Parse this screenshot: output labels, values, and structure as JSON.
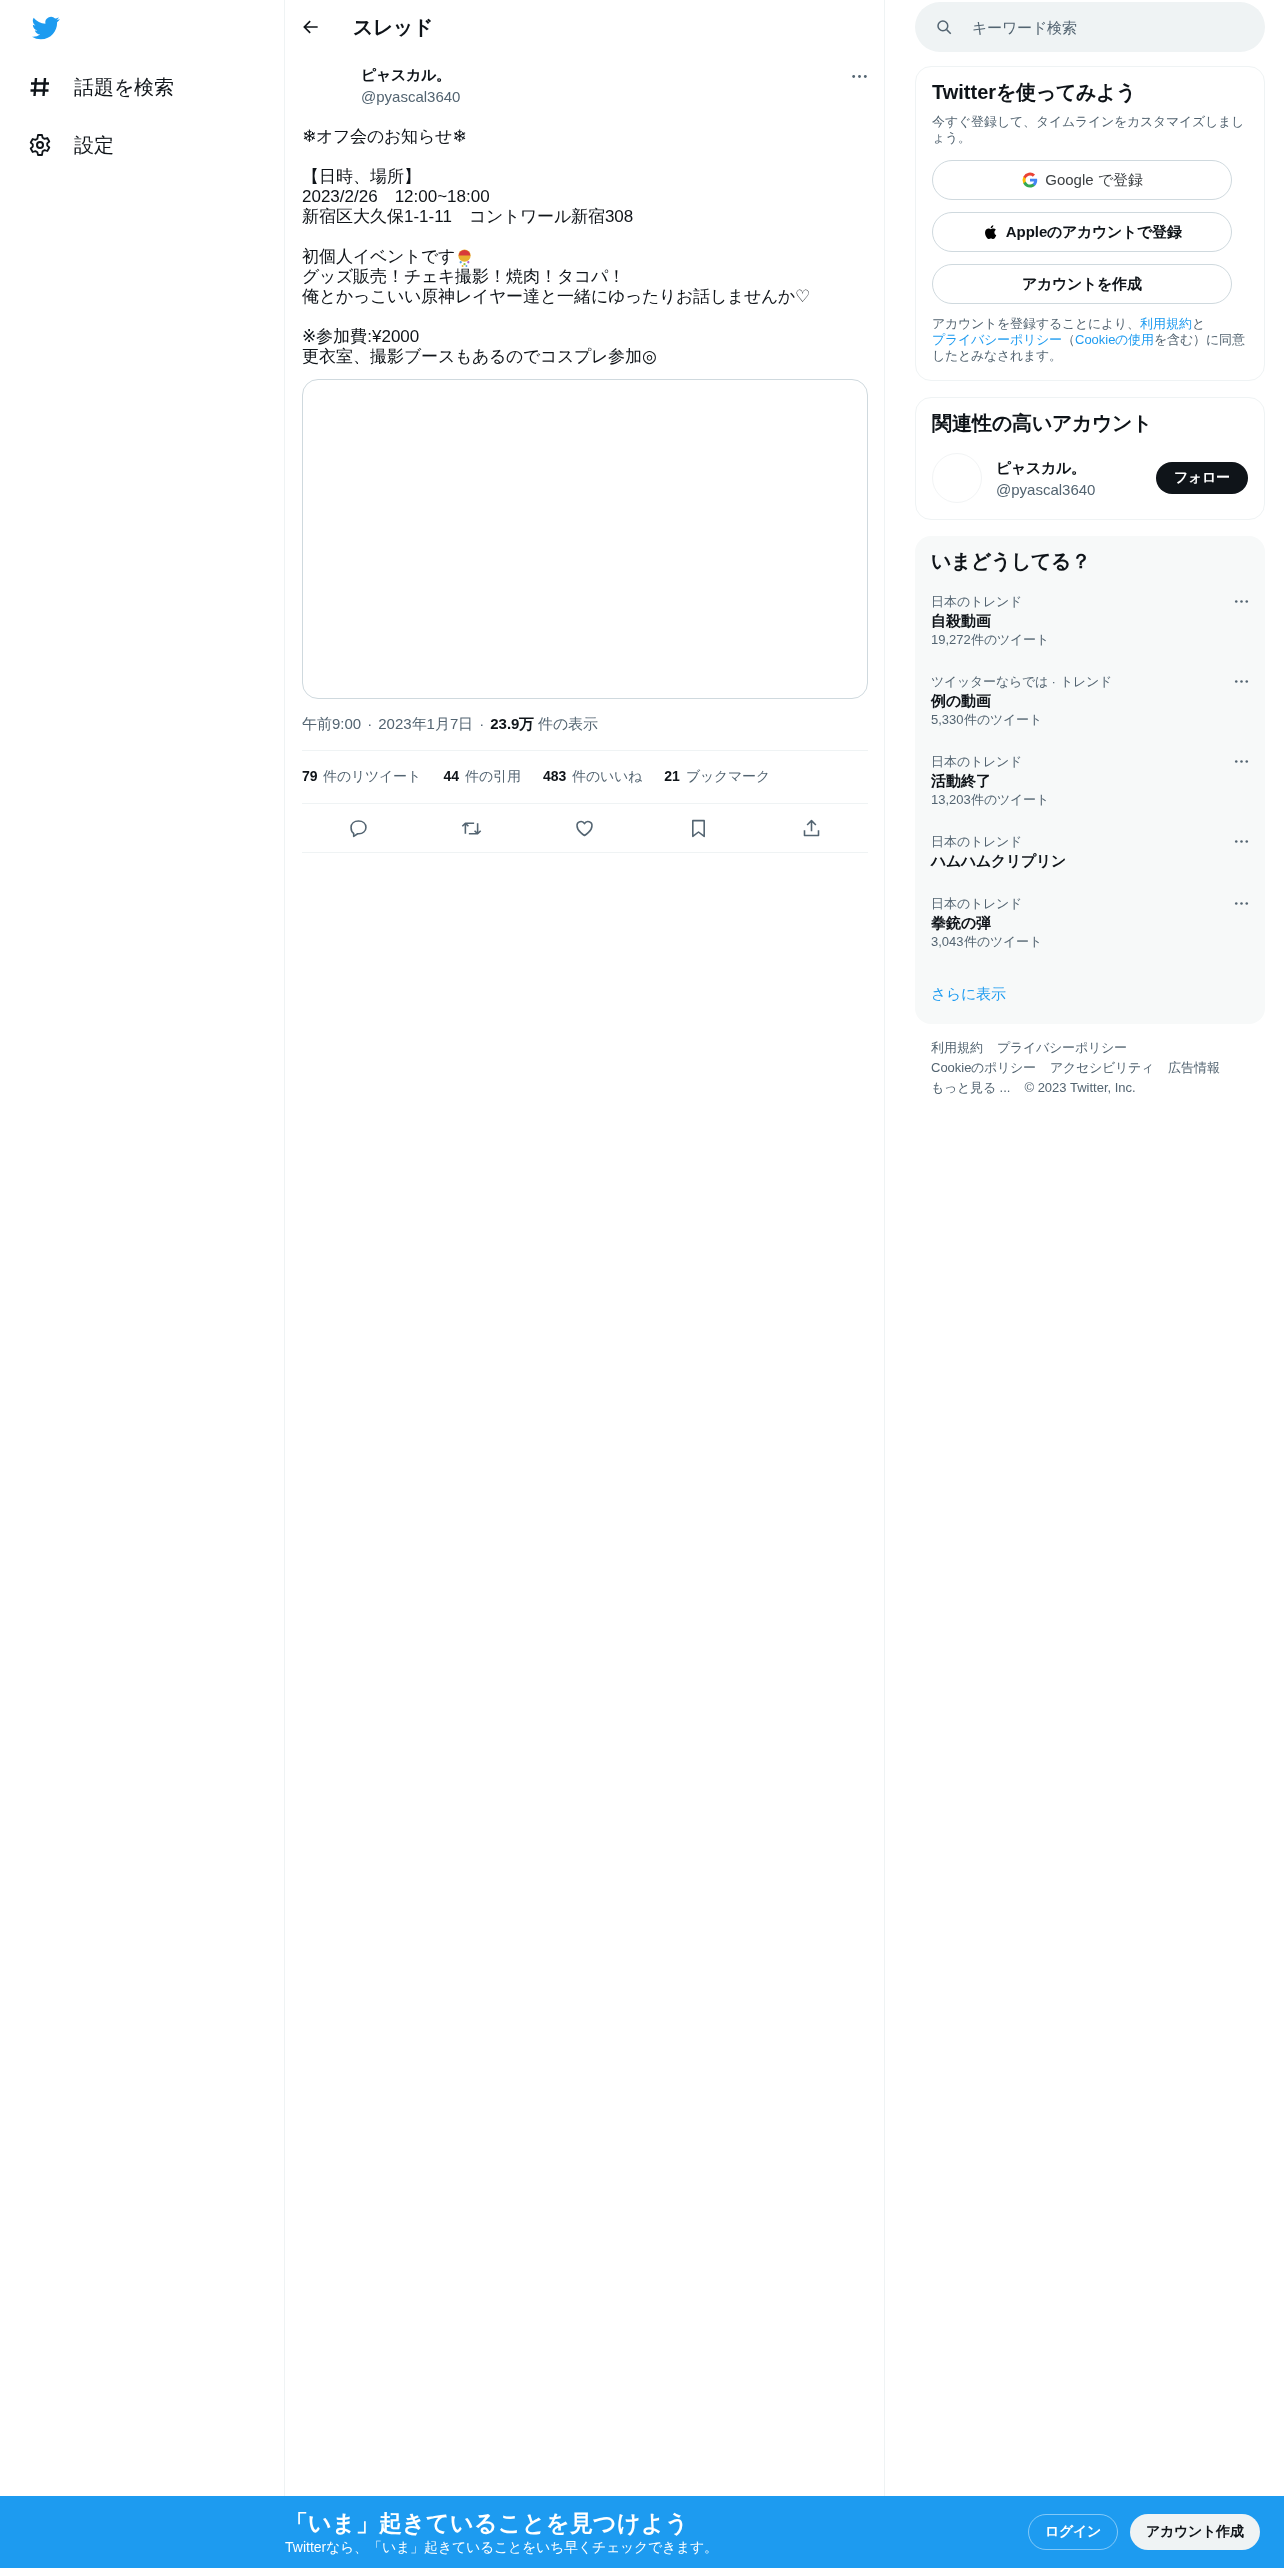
{
  "sidebar": {
    "items": [
      {
        "kind": "hashtag",
        "label": "話題を検索"
      },
      {
        "kind": "settings",
        "label": "設定"
      }
    ]
  },
  "header": {
    "title": "スレッド"
  },
  "tweet": {
    "name": "ピャスカル。",
    "handle": "@pyascal3640",
    "paragraphs": [
      [
        {
          "text": "❄オフ会のお知らせ❄"
        }
      ],
      [
        {
          "text": "【日時、場所】"
        },
        {
          "text": "2023/2/26　12:00~18:00"
        },
        {
          "text": "新宿区大久保1-1-11　コントワール新宿308"
        }
      ],
      [
        {
          "text": "初個人イベントです",
          "trailing_emoji": true
        },
        {
          "text": "グッズ販売！チェキ撮影！焼肉！タコパ！"
        },
        {
          "text": "俺とかっこいい原神レイヤー達と一緒にゆったりお話しませんか♡"
        }
      ],
      [
        {
          "text": "※参加費:¥2000"
        },
        {
          "text": "更衣室、撮影ブースもあるのでコスプレ参加◎"
        }
      ]
    ],
    "time": "午前9:00",
    "separator": "·",
    "date": "2023年1月7日",
    "views_count": "23.9万",
    "views_label": "件の表示",
    "stats": [
      {
        "count": "79",
        "label": "件のリツイート"
      },
      {
        "count": "44",
        "label": "件の引用"
      },
      {
        "count": "483",
        "label": "件のいいね"
      },
      {
        "count": "21",
        "label": "ブックマーク"
      }
    ],
    "actions": [
      {
        "kind": "reply"
      },
      {
        "kind": "retweet"
      },
      {
        "kind": "like"
      },
      {
        "kind": "bookmark"
      },
      {
        "kind": "share"
      }
    ]
  },
  "search": {
    "placeholder": "キーワード検索"
  },
  "signup": {
    "title": "Twitterを使ってみよう",
    "subtitle": "今すぐ登録して、タイムラインをカスタマイズしましょう。",
    "buttons": [
      {
        "kind": "google",
        "label": "Google で登録"
      },
      {
        "kind": "apple",
        "label": "Appleのアカウントで登録"
      },
      {
        "kind": "plain",
        "label": "アカウントを作成"
      }
    ],
    "legal_parts": [
      {
        "text": "アカウントを登録することにより、",
        "link": false
      },
      {
        "text": "利用規約",
        "link": true
      },
      {
        "text": "と",
        "link": false
      },
      {
        "text": "プライバシーポリシー",
        "link": true
      },
      {
        "text": "（",
        "link": false
      },
      {
        "text": "Cookieの使用",
        "link": true
      },
      {
        "text": "を含む）に同意したとみなされます。",
        "link": false
      }
    ]
  },
  "relevant": {
    "title": "関連性の高いアカウント",
    "name": "ピャスカル。",
    "handle": "@pyascal3640",
    "follow": "フォロー"
  },
  "trends": {
    "title": "いまどうしてる？",
    "items": [
      {
        "category": "日本のトレンド",
        "name": "自殺動画",
        "count": "19,272件のツイート"
      },
      {
        "category": "ツイッターならでは · トレンド",
        "name": "例の動画",
        "count": "5,330件のツイート"
      },
      {
        "category": "日本のトレンド",
        "name": "活動終了",
        "count": "13,203件のツイート"
      },
      {
        "category": "日本のトレンド",
        "name": "ハムハムクリプリン"
      },
      {
        "category": "日本のトレンド",
        "name": "拳銃の弾",
        "count": "3,043件のツイート"
      }
    ],
    "more": "さらに表示"
  },
  "footer": {
    "lines": [
      [
        "利用規約",
        "プライバシーポリシー"
      ],
      [
        "Cookieのポリシー",
        "アクセシビリティ",
        "広告情報"
      ],
      [
        "もっと見る ...",
        "© 2023 Twitter, Inc."
      ]
    ]
  },
  "bottom_bar": {
    "headline": "「いま」起きていることを見つけよう",
    "sub": "Twitterなら、「いま」起きていることをいち早くチェックできます。",
    "login": "ログイン",
    "signup": "アカウント作成"
  }
}
